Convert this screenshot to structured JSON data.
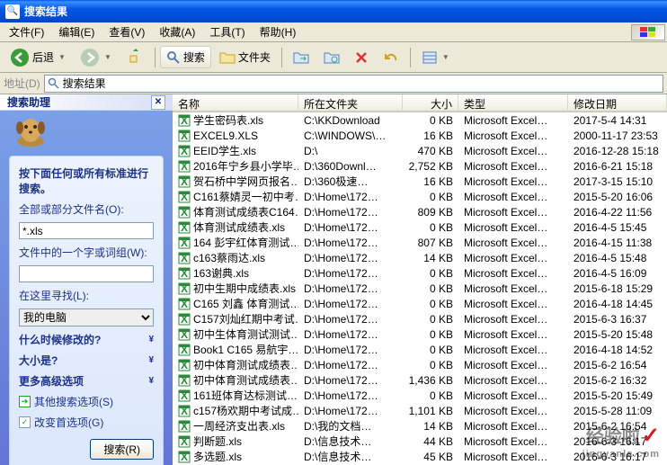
{
  "title": "搜索结果",
  "menu": {
    "file": "文件(F)",
    "edit": "编辑(E)",
    "view": "查看(V)",
    "fav": "收藏(A)",
    "tools": "工具(T)",
    "help": "帮助(H)"
  },
  "toolbar": {
    "back": "后退",
    "search": "搜索",
    "folders": "文件夹"
  },
  "address": {
    "label": "地址(D)",
    "value": "搜索结果"
  },
  "sidebar": {
    "header": "搜索助理",
    "prompt": "按下面任何或所有标准进行搜索。",
    "name_label": "全部或部分文件名(O):",
    "name_value": "*.xls",
    "word_label": "文件中的一个字或词组(W):",
    "word_value": "",
    "look_label": "在这里寻找(L):",
    "look_value": "我的电脑",
    "when_label": "什么时候修改的?",
    "size_label": "大小是?",
    "more_label": "更多高级选项",
    "other_label": "其他搜索选项(S)",
    "pref_label": "改变首选项(G)",
    "search_btn": "搜索(R)"
  },
  "columns": {
    "name": "名称",
    "loc": "所在文件夹",
    "size": "大小",
    "type": "类型",
    "date": "修改日期"
  },
  "files": [
    {
      "name": "学生密码表.xls",
      "loc": "C:\\KKDownload",
      "size": "0 KB",
      "type": "Microsoft Excel…",
      "date": "2017-5-4 14:31"
    },
    {
      "name": "EXCEL9.XLS",
      "loc": "C:\\WINDOWS\\…",
      "size": "16 KB",
      "type": "Microsoft Excel…",
      "date": "2000-11-17 23:53"
    },
    {
      "name": "EEID学生.xls",
      "loc": "D:\\",
      "size": "470 KB",
      "type": "Microsoft Excel…",
      "date": "2016-12-28 15:18"
    },
    {
      "name": "2016年宁乡县小学毕…",
      "loc": "D:\\360Downl…",
      "size": "2,752 KB",
      "type": "Microsoft Excel…",
      "date": "2016-6-21 15:18"
    },
    {
      "name": "贺石桥中学网页报名…",
      "loc": "D:\\360极速…",
      "size": "16 KB",
      "type": "Microsoft Excel…",
      "date": "2017-3-15 15:10"
    },
    {
      "name": "C161蔡婧灵一初中考…",
      "loc": "D:\\Home\\172…",
      "size": "0 KB",
      "type": "Microsoft Excel…",
      "date": "2015-5-20 16:06"
    },
    {
      "name": "体育测试成绩表C164…",
      "loc": "D:\\Home\\172…",
      "size": "809 KB",
      "type": "Microsoft Excel…",
      "date": "2016-4-22 11:56"
    },
    {
      "name": "体育测试成绩表.xls",
      "loc": "D:\\Home\\172…",
      "size": "0 KB",
      "type": "Microsoft Excel…",
      "date": "2016-4-5 15:45"
    },
    {
      "name": "164 彭宇红体育测试…",
      "loc": "D:\\Home\\172…",
      "size": "807 KB",
      "type": "Microsoft Excel…",
      "date": "2016-4-15 11:38"
    },
    {
      "name": "c163蔡雨达.xls",
      "loc": "D:\\Home\\172…",
      "size": "14 KB",
      "type": "Microsoft Excel…",
      "date": "2016-4-5 15:48"
    },
    {
      "name": "163谢典.xls",
      "loc": "D:\\Home\\172…",
      "size": "0 KB",
      "type": "Microsoft Excel…",
      "date": "2016-4-5 16:09"
    },
    {
      "name": "初中生期中成绩表.xls",
      "loc": "D:\\Home\\172…",
      "size": "0 KB",
      "type": "Microsoft Excel…",
      "date": "2015-6-18 15:29"
    },
    {
      "name": "C165 刘鑫 体育测试…",
      "loc": "D:\\Home\\172…",
      "size": "0 KB",
      "type": "Microsoft Excel…",
      "date": "2016-4-18 14:45"
    },
    {
      "name": "C157刘灿红期中考试…",
      "loc": "D:\\Home\\172…",
      "size": "0 KB",
      "type": "Microsoft Excel…",
      "date": "2015-6-3 16:37"
    },
    {
      "name": "初中生体育测试测试…",
      "loc": "D:\\Home\\172…",
      "size": "0 KB",
      "type": "Microsoft Excel…",
      "date": "2015-5-20 15:48"
    },
    {
      "name": "Book1  C165  易航宇…",
      "loc": "D:\\Home\\172…",
      "size": "0 KB",
      "type": "Microsoft Excel…",
      "date": "2016-4-18 14:52"
    },
    {
      "name": "初中体育测试成绩表…",
      "loc": "D:\\Home\\172…",
      "size": "0 KB",
      "type": "Microsoft Excel…",
      "date": "2015-6-2 16:54"
    },
    {
      "name": "初中体育测试成绩表…",
      "loc": "D:\\Home\\172…",
      "size": "1,436 KB",
      "type": "Microsoft Excel…",
      "date": "2015-6-2 16:32"
    },
    {
      "name": "161班体育达标测试…",
      "loc": "D:\\Home\\172…",
      "size": "0 KB",
      "type": "Microsoft Excel…",
      "date": "2015-5-20 15:49"
    },
    {
      "name": "c157杨欢期中考试成…",
      "loc": "D:\\Home\\172…",
      "size": "1,101 KB",
      "type": "Microsoft Excel…",
      "date": "2015-5-28 11:09"
    },
    {
      "name": "一周经济支出表.xls",
      "loc": "D:\\我的文档…",
      "size": "14 KB",
      "type": "Microsoft Excel…",
      "date": "2015-6-2 16:54"
    },
    {
      "name": "判断题.xls",
      "loc": "D:\\信息技术…",
      "size": "44 KB",
      "type": "Microsoft Excel…",
      "date": "2016-6-3 16:17"
    },
    {
      "name": "多选题.xls",
      "loc": "D:\\信息技术…",
      "size": "45 KB",
      "type": "Microsoft Excel…",
      "date": "2016-6-3 16:17"
    }
  ],
  "watermark": {
    "zh": "经验啦",
    "url": "jingyanla.com"
  }
}
